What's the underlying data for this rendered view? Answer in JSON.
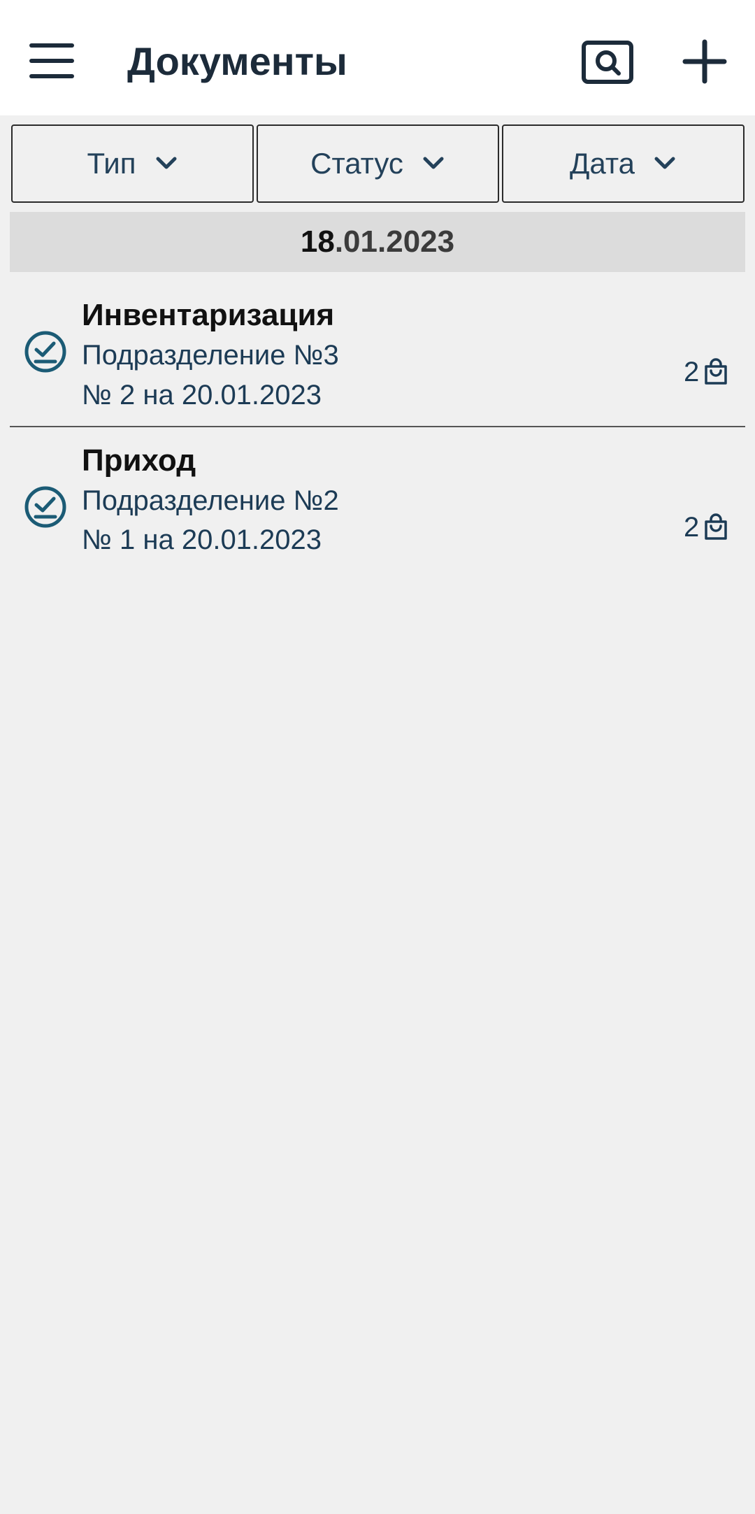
{
  "appbar": {
    "title": "Документы",
    "menu_icon": "hamburger-menu-icon",
    "search_icon": "search-document-icon",
    "add_icon": "plus-icon"
  },
  "filters": [
    {
      "label": "Тип",
      "icon": "chevron-down-icon"
    },
    {
      "label": "Статус",
      "icon": "chevron-down-icon"
    },
    {
      "label": "Дата",
      "icon": "chevron-down-icon"
    }
  ],
  "group": {
    "date_day": "18",
    "date_rest": ".01.2023"
  },
  "documents": [
    {
      "title": "Инвентаризация",
      "department": "Подразделение №3",
      "number": "№ 2 на 20.01.2023",
      "count": "2",
      "status_icon": "checked-circle-icon",
      "count_icon": "shopping-bag-icon"
    },
    {
      "title": "Приход",
      "department": "Подразделение №2",
      "number": "№ 1 на 20.01.2023",
      "count": "2",
      "status_icon": "checked-circle-icon",
      "count_icon": "shopping-bag-icon"
    }
  ],
  "colors": {
    "primary": "#1c2b3a",
    "accent": "#1b5b75",
    "background": "#f0f0f0",
    "header_band": "#dcdcdc"
  }
}
